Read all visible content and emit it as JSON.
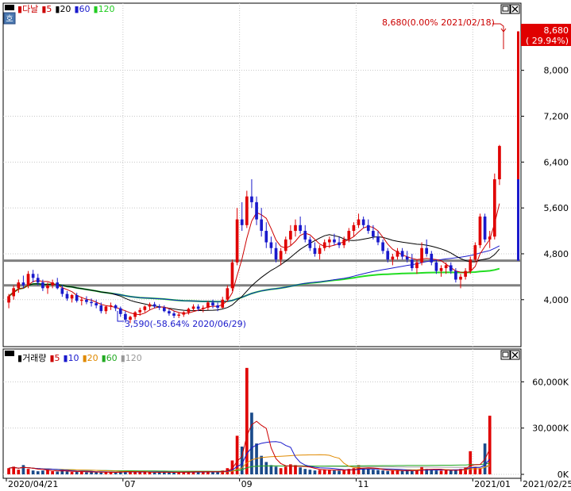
{
  "chart_data": [
    {
      "type": "candlestick",
      "panel": "price",
      "legend": [
        {
          "text": "다날",
          "color": "#cc0000"
        },
        {
          "text": "5",
          "color": "#cc0000"
        },
        {
          "text": "20",
          "color": "#000000"
        },
        {
          "text": "60",
          "color": "#1a1acc"
        },
        {
          "text": "120",
          "color": "#22cc22"
        }
      ],
      "y_ticks": [
        "8,000",
        "7,200",
        "6,400",
        "5,600",
        "4,800",
        "4,000"
      ],
      "y_tick_values": [
        8000,
        7200,
        6400,
        5600,
        4800,
        4000
      ],
      "ylim": [
        3250,
        8950
      ],
      "current_price": "8,680",
      "current_change": "( 29.94%)",
      "high_annotation": "8,680(0.00% 2021/02/18)",
      "low_annotation": "3,590(-58.64% 2020/06/29)",
      "high_value": 8680,
      "low_value": 3590,
      "horizontal_lines": [
        4680,
        4250
      ],
      "ohlc": [
        [
          3950,
          4100,
          3850,
          4060
        ],
        [
          4060,
          4250,
          4000,
          4200
        ],
        [
          4200,
          4350,
          4120,
          4300
        ],
        [
          4300,
          4420,
          4200,
          4250
        ],
        [
          4250,
          4500,
          4200,
          4450
        ],
        [
          4450,
          4520,
          4300,
          4380
        ],
        [
          4380,
          4450,
          4250,
          4300
        ],
        [
          4300,
          4350,
          4150,
          4200
        ],
        [
          4200,
          4300,
          4100,
          4250
        ],
        [
          4250,
          4350,
          4200,
          4300
        ],
        [
          4300,
          4380,
          4180,
          4200
        ],
        [
          4200,
          4260,
          4050,
          4100
        ],
        [
          4100,
          4150,
          3980,
          4020
        ],
        [
          4020,
          4100,
          3950,
          4080
        ],
        [
          4080,
          4120,
          3950,
          3980
        ],
        [
          3980,
          4050,
          3900,
          4000
        ],
        [
          4000,
          4060,
          3920,
          3960
        ],
        [
          3960,
          4020,
          3880,
          3940
        ],
        [
          3940,
          4000,
          3850,
          3900
        ],
        [
          3900,
          3950,
          3760,
          3800
        ],
        [
          3800,
          3900,
          3750,
          3880
        ],
        [
          3880,
          3950,
          3820,
          3900
        ],
        [
          3900,
          3920,
          3800,
          3850
        ],
        [
          3850,
          3880,
          3700,
          3750
        ],
        [
          3750,
          3800,
          3600,
          3650
        ],
        [
          3650,
          3720,
          3590,
          3700
        ],
        [
          3700,
          3800,
          3650,
          3780
        ],
        [
          3780,
          3860,
          3720,
          3820
        ],
        [
          3820,
          3900,
          3780,
          3880
        ],
        [
          3880,
          3950,
          3820,
          3920
        ],
        [
          3920,
          3960,
          3850,
          3880
        ],
        [
          3880,
          3920,
          3820,
          3860
        ],
        [
          3860,
          3900,
          3780,
          3800
        ],
        [
          3800,
          3840,
          3720,
          3760
        ],
        [
          3760,
          3800,
          3680,
          3720
        ],
        [
          3720,
          3780,
          3680,
          3740
        ],
        [
          3740,
          3800,
          3700,
          3780
        ],
        [
          3780,
          3860,
          3740,
          3840
        ],
        [
          3840,
          3920,
          3800,
          3880
        ],
        [
          3880,
          3920,
          3800,
          3840
        ],
        [
          3840,
          3900,
          3780,
          3860
        ],
        [
          3860,
          3980,
          3820,
          3950
        ],
        [
          3950,
          4000,
          3850,
          3900
        ],
        [
          3900,
          3950,
          3800,
          3860
        ],
        [
          3860,
          4050,
          3850,
          4000
        ],
        [
          4000,
          4250,
          3980,
          4200
        ],
        [
          4200,
          4700,
          4150,
          4650
        ],
        [
          4650,
          5600,
          4600,
          5400
        ],
        [
          5400,
          5700,
          5200,
          5300
        ],
        [
          5300,
          5900,
          5250,
          5800
        ],
        [
          5800,
          6100,
          5600,
          5700
        ],
        [
          5700,
          5800,
          5300,
          5400
        ],
        [
          5400,
          5600,
          5100,
          5200
        ],
        [
          5200,
          5350,
          4900,
          5000
        ],
        [
          5000,
          5100,
          4800,
          4900
        ],
        [
          4900,
          5000,
          4650,
          4700
        ],
        [
          4700,
          4900,
          4600,
          4850
        ],
        [
          4850,
          5100,
          4800,
          5050
        ],
        [
          5050,
          5300,
          4950,
          5200
        ],
        [
          5200,
          5400,
          5100,
          5300
        ],
        [
          5300,
          5450,
          5150,
          5200
        ],
        [
          5200,
          5300,
          5000,
          5050
        ],
        [
          5050,
          5100,
          4850,
          4900
        ],
        [
          4900,
          5000,
          4750,
          4800
        ],
        [
          4800,
          4950,
          4700,
          4900
        ],
        [
          4900,
          5050,
          4850,
          5000
        ],
        [
          5000,
          5100,
          4900,
          5050
        ],
        [
          5050,
          5150,
          4950,
          5000
        ],
        [
          5000,
          5100,
          4900,
          4950
        ],
        [
          4950,
          5100,
          4900,
          5050
        ],
        [
          5050,
          5250,
          5000,
          5200
        ],
        [
          5200,
          5350,
          5100,
          5300
        ],
        [
          5300,
          5500,
          5250,
          5400
        ],
        [
          5400,
          5450,
          5250,
          5300
        ],
        [
          5300,
          5400,
          5150,
          5200
        ],
        [
          5200,
          5300,
          5050,
          5100
        ],
        [
          5100,
          5200,
          4950,
          5000
        ],
        [
          5000,
          5050,
          4800,
          4850
        ],
        [
          4850,
          4900,
          4650,
          4700
        ],
        [
          4700,
          4800,
          4600,
          4750
        ],
        [
          4750,
          4900,
          4700,
          4850
        ],
        [
          4850,
          4900,
          4700,
          4750
        ],
        [
          4750,
          4850,
          4650,
          4700
        ],
        [
          4700,
          4800,
          4500,
          4550
        ],
        [
          4550,
          4700,
          4450,
          4650
        ],
        [
          4650,
          5000,
          4600,
          4900
        ],
        [
          4900,
          5050,
          4750,
          4800
        ],
        [
          4800,
          4850,
          4600,
          4650
        ],
        [
          4650,
          4700,
          4450,
          4500
        ],
        [
          4500,
          4600,
          4400,
          4550
        ],
        [
          4550,
          4650,
          4450,
          4600
        ],
        [
          4600,
          4650,
          4450,
          4500
        ],
        [
          4500,
          4550,
          4300,
          4350
        ],
        [
          4350,
          4450,
          4200,
          4400
        ],
        [
          4400,
          4550,
          4350,
          4500
        ],
        [
          4500,
          4750,
          4450,
          4700
        ],
        [
          4700,
          5000,
          4650,
          4950
        ],
        [
          4950,
          5500,
          4900,
          5450
        ],
        [
          5450,
          5500,
          5000,
          5050
        ],
        [
          5050,
          5200,
          4900,
          5100
        ],
        [
          5100,
          6200,
          5050,
          6100
        ],
        [
          6100,
          6700,
          6000,
          6680
        ]
      ]
    },
    {
      "type": "bar",
      "panel": "volume",
      "legend": [
        {
          "text": "거래량",
          "color": "#000000"
        },
        {
          "text": "5",
          "color": "#cc0000"
        },
        {
          "text": "10",
          "color": "#1a1acc"
        },
        {
          "text": "20",
          "color": "#e08a00"
        },
        {
          "text": "60",
          "color": "#22aa22"
        },
        {
          "text": "120",
          "color": "#999999"
        }
      ],
      "y_ticks": [
        "60,000K",
        "30,000K",
        "0K"
      ],
      "y_tick_values": [
        60000,
        30000,
        0
      ],
      "ylim": [
        0,
        72000
      ],
      "values": [
        4000,
        5000,
        3000,
        6000,
        3500,
        2500,
        2000,
        2500,
        3000,
        2000,
        1800,
        2200,
        2000,
        1500,
        1800,
        1600,
        1400,
        1500,
        1300,
        1200,
        1500,
        1300,
        1200,
        1800,
        2500,
        1600,
        1400,
        1300,
        1500,
        1400,
        1200,
        1300,
        1500,
        1200,
        1300,
        1400,
        1500,
        1700,
        2000,
        1600,
        1500,
        1800,
        1700,
        1600,
        2500,
        4000,
        9000,
        25000,
        18000,
        69000,
        40000,
        20000,
        12000,
        8000,
        6000,
        5000,
        4000,
        5000,
        6500,
        6000,
        4500,
        3500,
        3000,
        2500,
        2800,
        3200,
        3000,
        2500,
        2400,
        2800,
        3500,
        4000,
        6000,
        4000,
        3500,
        3000,
        2800,
        2500,
        2200,
        2400,
        2600,
        2400,
        2300,
        2200,
        2500,
        5000,
        3500,
        3000,
        2500,
        2400,
        2600,
        2500,
        3000,
        3500,
        4500,
        15000,
        5000,
        4000,
        20000,
        38000
      ],
      "colors": "alternating-red-blue"
    }
  ],
  "x_ticks": [
    "2020/04/21",
    "07",
    "09",
    "11",
    "2021/01",
    "2021/02/25"
  ]
}
